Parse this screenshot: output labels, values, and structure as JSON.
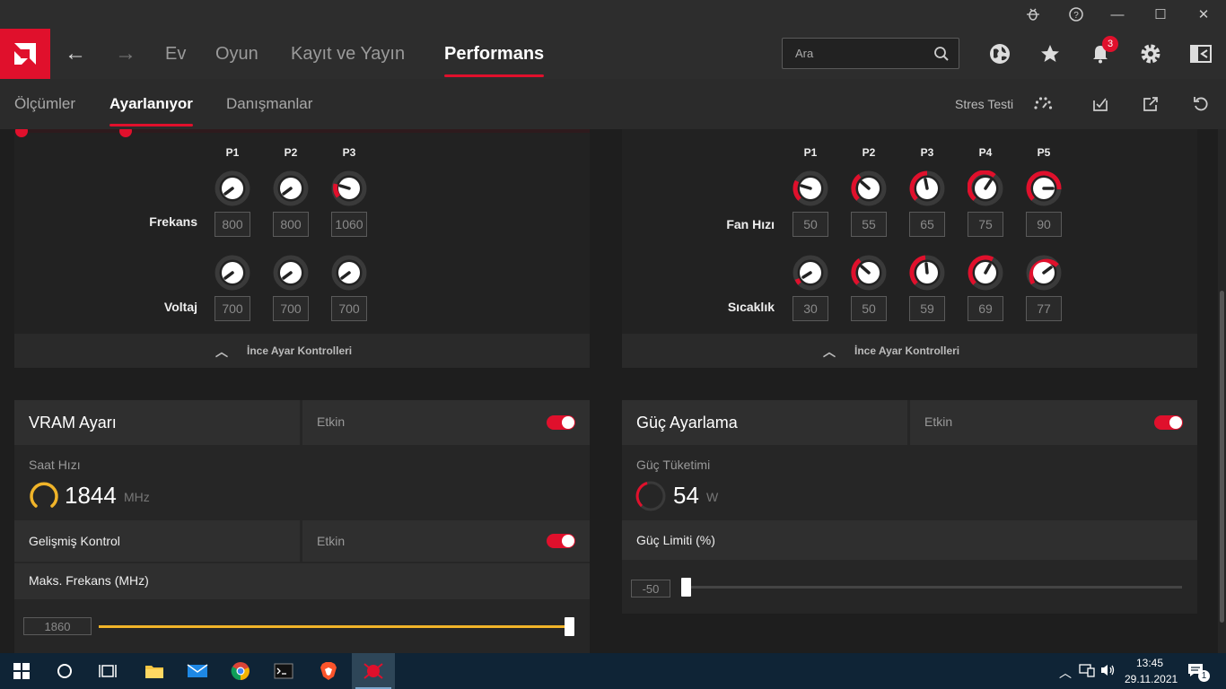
{
  "window": {
    "bug_icon": "bug-icon",
    "help_icon": "help-icon",
    "minimize": "—",
    "maximize": "☐",
    "close": "✕"
  },
  "nav": {
    "tabs": [
      {
        "label": "Ev"
      },
      {
        "label": "Oyun"
      },
      {
        "label": "Kayıt ve Yayın"
      },
      {
        "label": "Performans"
      }
    ],
    "search_placeholder": "Ara",
    "notification_count": "3",
    "accent": "#e0102c"
  },
  "subnav": {
    "tabs": [
      {
        "label": "Ölçümler"
      },
      {
        "label": "Ayarlanıyor"
      },
      {
        "label": "Danışmanlar"
      }
    ],
    "stress_test": "Stres Testi"
  },
  "gpu_curve": {
    "points": [
      "P1",
      "P2",
      "P3"
    ],
    "freq_label": "Frekans",
    "volt_label": "Voltaj",
    "freq_values": [
      "800",
      "800",
      "1060"
    ],
    "volt_values": [
      "700",
      "700",
      "700"
    ],
    "fine_tune": "İnce Ayar Kontrolleri"
  },
  "fan_curve": {
    "points": [
      "P1",
      "P2",
      "P3",
      "P4",
      "P5"
    ],
    "speed_label": "Fan Hızı",
    "temp_label": "Sıcaklık",
    "speed_values": [
      "50",
      "55",
      "65",
      "75",
      "90"
    ],
    "temp_values": [
      "30",
      "50",
      "59",
      "69",
      "77"
    ],
    "fine_tune": "İnce Ayar Kontrolleri"
  },
  "vram": {
    "title": "VRAM Ayarı",
    "enabled_label": "Etkin",
    "clock_label": "Saat Hızı",
    "clock_value": "1844",
    "clock_unit": "MHz",
    "advanced_label": "Gelişmiş Kontrol",
    "advanced_enabled": "Etkin",
    "max_freq_label": "Maks. Frekans (MHz)",
    "max_freq_value": "1860",
    "slider_fraction": 1.0,
    "slider_color": "#f0b429"
  },
  "power": {
    "title": "Güç Ayarlama",
    "enabled_label": "Etkin",
    "consumption_label": "Güç Tüketimi",
    "consumption_value": "54",
    "consumption_unit": "W",
    "limit_label": "Güç Limiti (%)",
    "limit_value": "-50",
    "slider_fraction": 0.0
  },
  "taskbar": {
    "time": "13:45",
    "date": "29.11.2021",
    "notif_count": "1"
  }
}
